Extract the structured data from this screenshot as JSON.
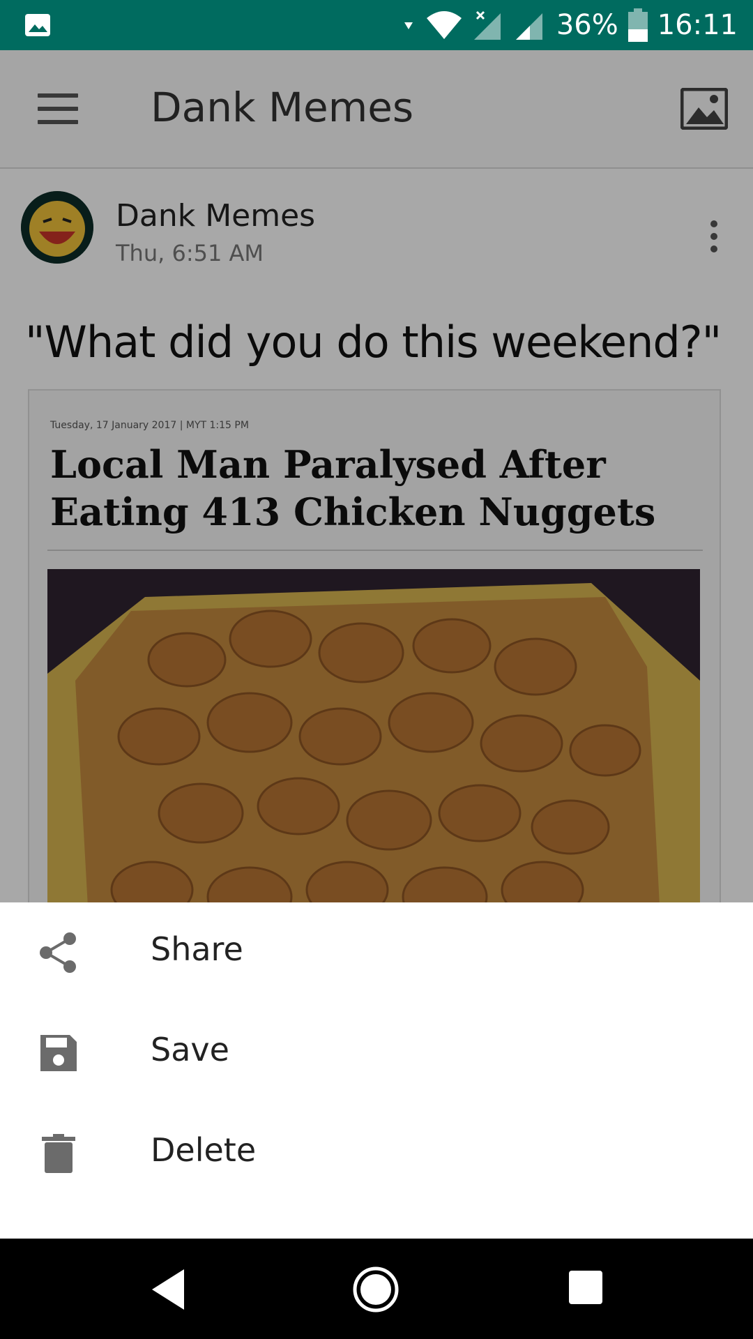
{
  "status_bar": {
    "battery": "36%",
    "time": "16:11",
    "background": "#006b5f"
  },
  "toolbar": {
    "title": "Dank Memes",
    "menu_icon": "hamburger-menu-icon",
    "gallery_icon": "image-icon"
  },
  "post": {
    "author": "Dank Memes",
    "time": "Thu, 6:51 AM",
    "caption": "\"What did you do this weekend?\"",
    "article": {
      "dateline": "Tuesday, 17 January 2017 | MYT 1:15 PM",
      "headline": "Local Man Paralysed After Eating 413 Chicken Nuggets"
    }
  },
  "bottom_sheet": {
    "items": [
      {
        "label": "Share",
        "icon": "share-icon"
      },
      {
        "label": "Save",
        "icon": "save-icon"
      },
      {
        "label": "Delete",
        "icon": "delete-icon"
      }
    ]
  },
  "nav_bar": {
    "back_icon": "back-icon",
    "home_icon": "home-icon",
    "recents_icon": "recents-icon"
  }
}
